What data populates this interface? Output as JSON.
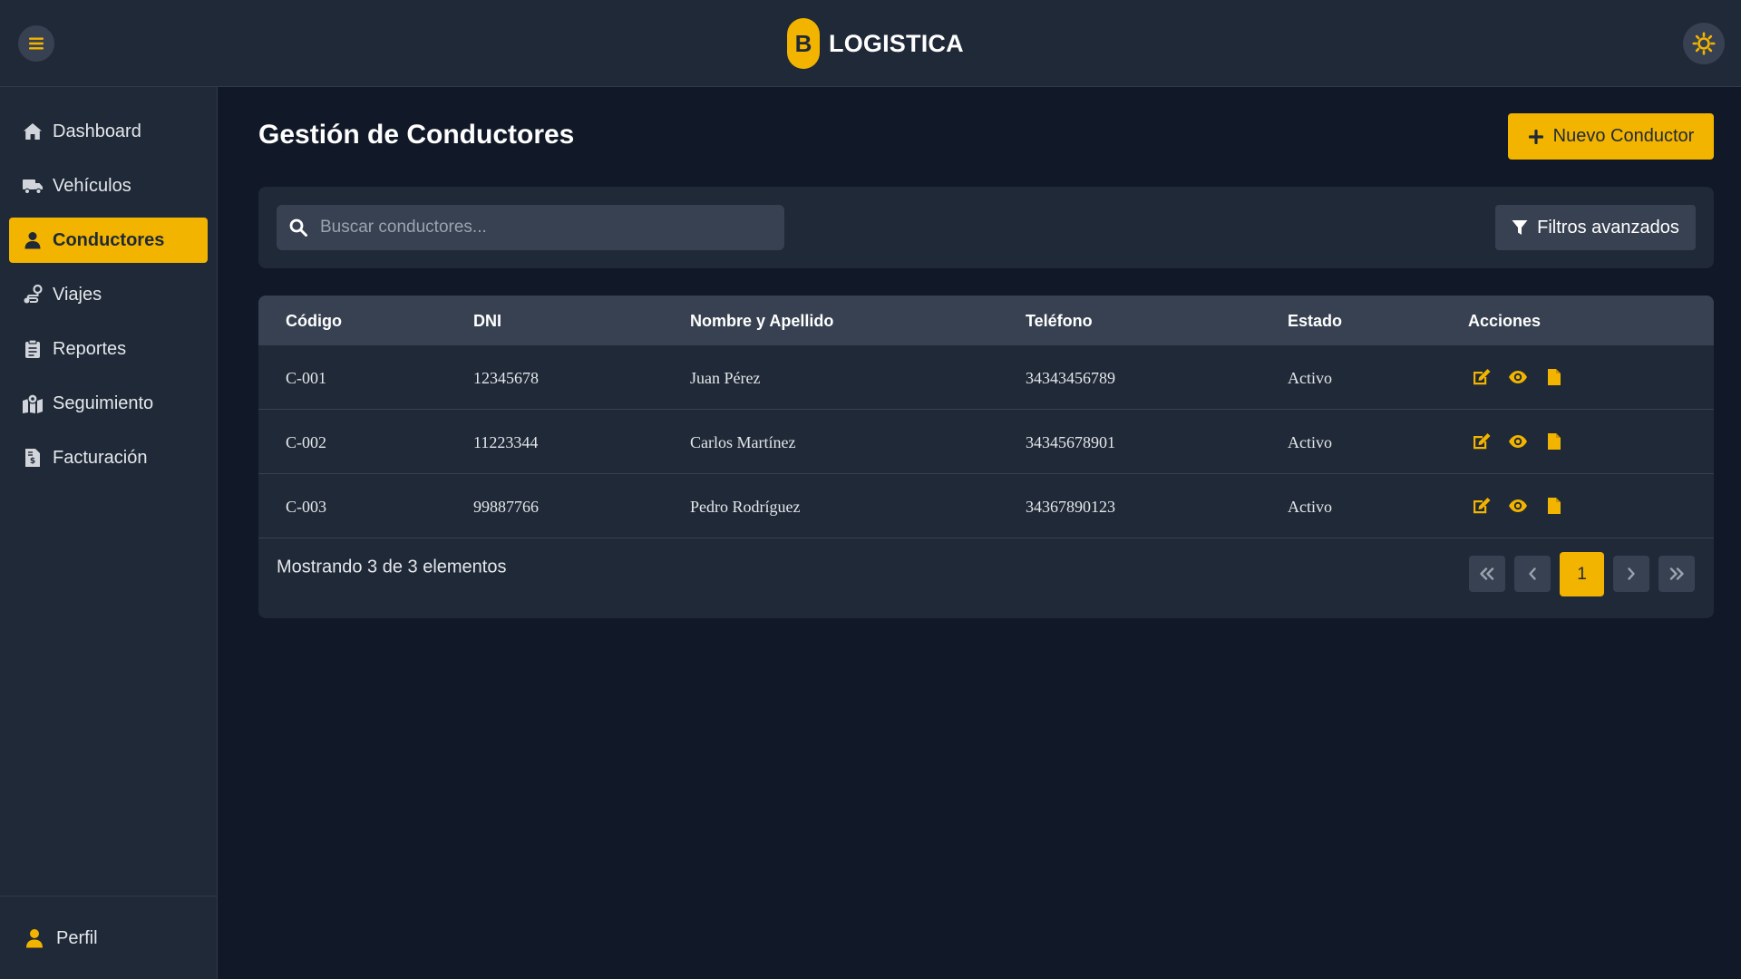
{
  "brand": {
    "badge": "B",
    "name": "LOGISTICA"
  },
  "sidebar": {
    "items": [
      {
        "label": "Dashboard",
        "icon": "home-icon",
        "active": false
      },
      {
        "label": "Vehículos",
        "icon": "truck-icon",
        "active": false
      },
      {
        "label": "Conductores",
        "icon": "user-icon",
        "active": true
      },
      {
        "label": "Viajes",
        "icon": "route-icon",
        "active": false
      },
      {
        "label": "Reportes",
        "icon": "clipboard-icon",
        "active": false
      },
      {
        "label": "Seguimiento",
        "icon": "map-marker-icon",
        "active": false
      },
      {
        "label": "Facturación",
        "icon": "invoice-icon",
        "active": false
      }
    ],
    "profile_label": "Perfil"
  },
  "main": {
    "title": "Gestión de Conductores",
    "new_button_label": "Nuevo Conductor",
    "search_placeholder": "Buscar conductores...",
    "filters_label": "Filtros avanzados",
    "table": {
      "headers": [
        "Código",
        "DNI",
        "Nombre y Apellido",
        "Teléfono",
        "Estado",
        "Acciones"
      ],
      "rows": [
        {
          "codigo": "C-001",
          "dni": "12345678",
          "nombre": "Juan Pérez",
          "telefono": "34343456789",
          "estado": "Activo"
        },
        {
          "codigo": "C-002",
          "dni": "11223344",
          "nombre": "Carlos Martínez",
          "telefono": "34345678901",
          "estado": "Activo"
        },
        {
          "codigo": "C-003",
          "dni": "99887766",
          "nombre": "Pedro Rodríguez",
          "telefono": "34367890123",
          "estado": "Activo"
        }
      ],
      "row_actions": [
        "edit-icon",
        "view-icon",
        "document-icon"
      ]
    },
    "footer_text": "Mostrando 3 de 3 elementos",
    "pagination": {
      "current_page": "1"
    }
  },
  "colors": {
    "accent": "#f3b400",
    "background": "#111827",
    "panel": "#1f2937",
    "header_row": "#374151"
  }
}
